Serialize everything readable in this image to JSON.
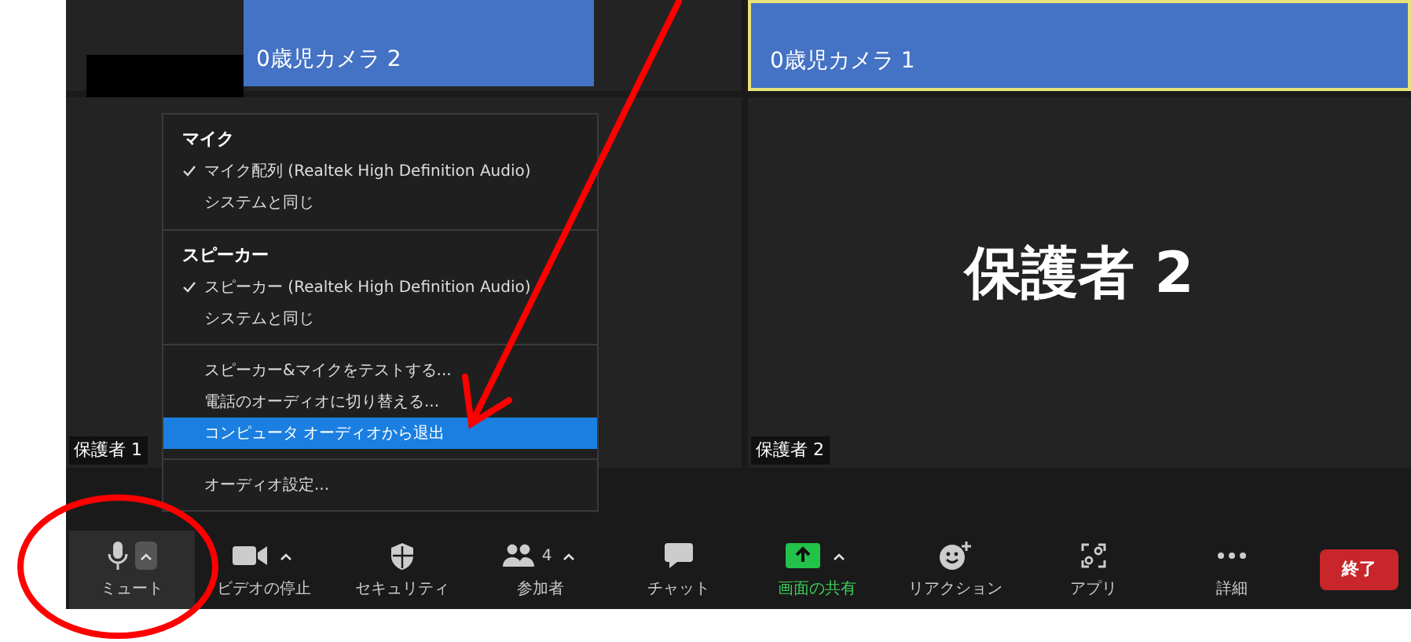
{
  "tiles": [
    {
      "label": "0歳児カメラ 2",
      "kind": "camera",
      "highlighted": false
    },
    {
      "label": "0歳児カメラ 1",
      "kind": "full",
      "highlighted": true
    },
    {
      "label": "保護者 1",
      "kind": "name",
      "highlighted": false
    },
    {
      "label": "保護者 2",
      "kind": "name",
      "highlighted": false,
      "big_text": "保護者 2"
    }
  ],
  "audio_menu": [
    {
      "heading": "マイク",
      "items": [
        {
          "label": "マイク配列 (Realtek High Definition Audio)",
          "checked": true,
          "selected": false
        },
        {
          "label": "システムと同じ",
          "checked": false,
          "selected": false
        }
      ]
    },
    {
      "heading": "スピーカー",
      "items": [
        {
          "label": "スピーカー (Realtek High Definition Audio)",
          "checked": true,
          "selected": false
        },
        {
          "label": "システムと同じ",
          "checked": false,
          "selected": false
        }
      ]
    },
    {
      "items": [
        {
          "label": "スピーカー&マイクをテストする...",
          "checked": false,
          "selected": false
        },
        {
          "label": "電話のオーディオに切り替える...",
          "checked": false,
          "selected": false
        },
        {
          "label": "コンピュータ オーディオから退出",
          "checked": false,
          "selected": true
        }
      ]
    },
    {
      "items": [
        {
          "label": "オーディオ設定...",
          "checked": false,
          "selected": false
        }
      ]
    }
  ],
  "toolbar": [
    {
      "kind": "mic",
      "label": "ミュート",
      "caret": true,
      "selected": true
    },
    {
      "kind": "video",
      "label": "ビデオの停止",
      "caret": true,
      "selected": false
    },
    {
      "kind": "shield",
      "label": "セキュリティ",
      "caret": false,
      "selected": false
    },
    {
      "kind": "people",
      "label": "参加者",
      "count": "4",
      "caret": true,
      "selected": false
    },
    {
      "kind": "chat",
      "label": "チャット",
      "caret": false,
      "selected": false
    },
    {
      "kind": "share",
      "label": "画面の共有",
      "caret": true,
      "selected": false,
      "active": true
    },
    {
      "kind": "smile",
      "label": "リアクション",
      "caret": false,
      "selected": false
    },
    {
      "kind": "apps",
      "label": "アプリ",
      "caret": false,
      "selected": false
    },
    {
      "kind": "dots",
      "label": "詳細",
      "caret": false,
      "selected": false
    }
  ],
  "end_button": "終了"
}
